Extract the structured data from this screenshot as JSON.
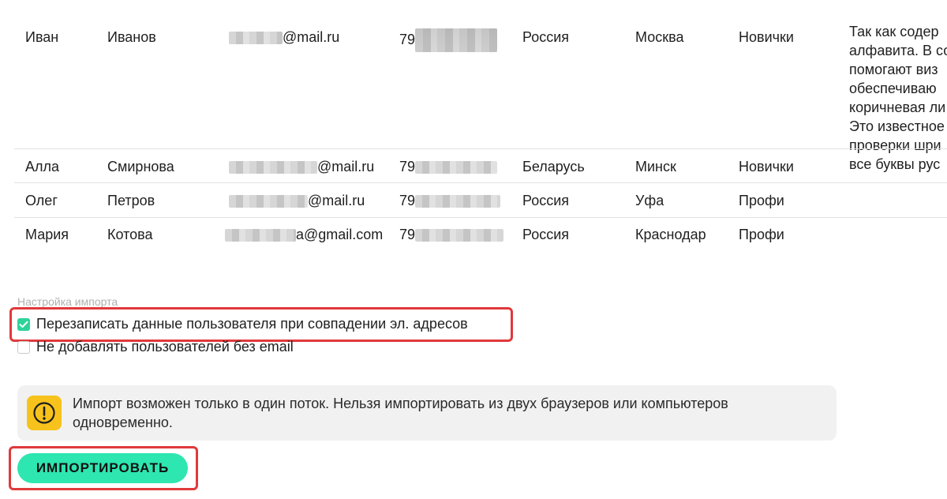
{
  "table": {
    "rows": [
      {
        "first": "Иван",
        "last": "Иванов",
        "email": "@mail.ru",
        "phone": "79",
        "country": "Россия",
        "city": "Москва",
        "group": "Новички"
      },
      {
        "first": "Алла",
        "last": "Смирнова",
        "email": "@mail.ru",
        "phone": "79",
        "country": "Беларусь",
        "city": "Минск",
        "group": "Новички"
      },
      {
        "first": "Олег",
        "last": "Петров",
        "email": "@mail.ru",
        "phone": "79",
        "country": "Россия",
        "city": "Уфа",
        "group": "Профи"
      },
      {
        "first": "Мария",
        "last": "Котова",
        "email": "a@gmail.com",
        "phone": "79",
        "country": "Россия",
        "city": "Краснодар",
        "group": "Профи"
      }
    ],
    "description_lines": [
      "Так как содер",
      "алфавита. В со",
      "помогают виз",
      "обеспечиваю",
      "коричневая ли",
      "Это известное",
      "проверки шри",
      "все буквы рус"
    ]
  },
  "settings": {
    "title": "Настройка импорта",
    "overwrite_label": "Перезаписать данные пользователя при совпадении эл. адресов",
    "overwrite_checked": true,
    "skip_no_email_label": "Не добавлять пользователей без email",
    "skip_no_email_checked": false
  },
  "notice": {
    "icon": "exclamation-circle-icon",
    "text": "Импорт возможен только в один поток. Нельзя импортировать из двух браузеров или компьютеров одновременно."
  },
  "import_button": {
    "label": "ИМПОРТИРОВАТЬ"
  },
  "colors": {
    "accent": "#2ee6b0",
    "checkbox_on": "#2ed39a",
    "warning": "#f7c21b",
    "highlight": "#e0393b"
  }
}
